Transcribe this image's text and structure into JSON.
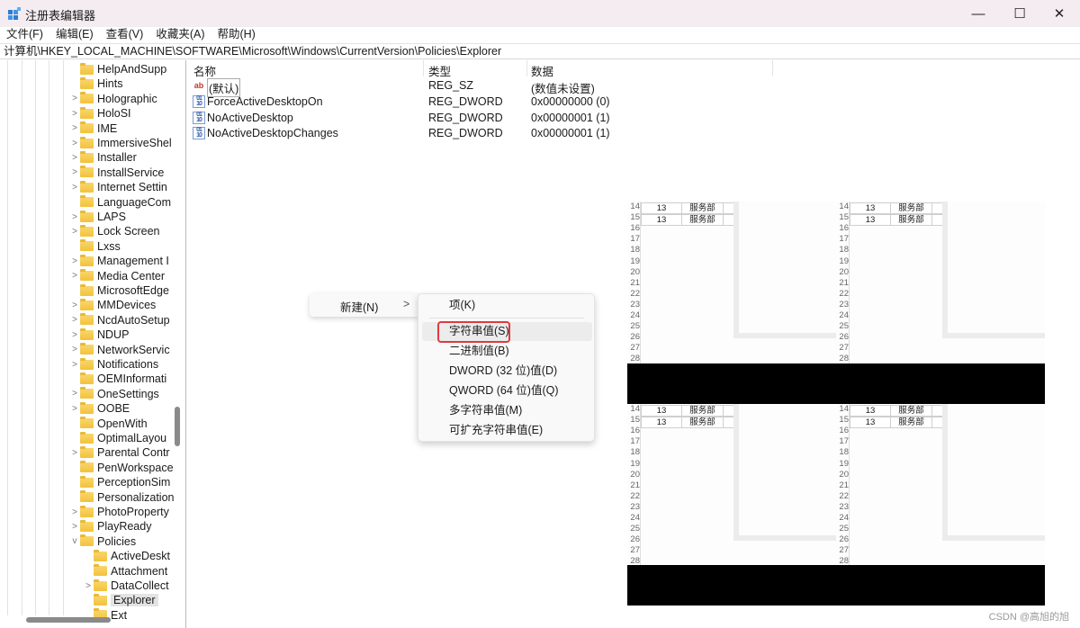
{
  "window": {
    "title": "注册表编辑器",
    "minimize": "—",
    "maximize": "☐",
    "close": "✕"
  },
  "menu": [
    "文件(F)",
    "编辑(E)",
    "查看(V)",
    "收藏夹(A)",
    "帮助(H)"
  ],
  "address": "计算机\\HKEY_LOCAL_MACHINE\\SOFTWARE\\Microsoft\\Windows\\CurrentVersion\\Policies\\Explorer",
  "tree": [
    {
      "label": "HelpAndSupp",
      "exp": "",
      "lvl": 0
    },
    {
      "label": "Hints",
      "exp": "",
      "lvl": 0
    },
    {
      "label": "Holographic",
      "exp": ">",
      "lvl": 0
    },
    {
      "label": "HoloSI",
      "exp": ">",
      "lvl": 0
    },
    {
      "label": "IME",
      "exp": ">",
      "lvl": 0
    },
    {
      "label": "ImmersiveShel",
      "exp": ">",
      "lvl": 0
    },
    {
      "label": "Installer",
      "exp": ">",
      "lvl": 0
    },
    {
      "label": "InstallService",
      "exp": ">",
      "lvl": 0
    },
    {
      "label": "Internet Settin",
      "exp": ">",
      "lvl": 0
    },
    {
      "label": "LanguageCom",
      "exp": "",
      "lvl": 0
    },
    {
      "label": "LAPS",
      "exp": ">",
      "lvl": 0
    },
    {
      "label": "Lock Screen",
      "exp": ">",
      "lvl": 0
    },
    {
      "label": "Lxss",
      "exp": "",
      "lvl": 0
    },
    {
      "label": "Management I",
      "exp": ">",
      "lvl": 0
    },
    {
      "label": "Media Center",
      "exp": ">",
      "lvl": 0
    },
    {
      "label": "MicrosoftEdge",
      "exp": "",
      "lvl": 0
    },
    {
      "label": "MMDevices",
      "exp": ">",
      "lvl": 0
    },
    {
      "label": "NcdAutoSetup",
      "exp": ">",
      "lvl": 0
    },
    {
      "label": "NDUP",
      "exp": ">",
      "lvl": 0
    },
    {
      "label": "NetworkServic",
      "exp": ">",
      "lvl": 0
    },
    {
      "label": "Notifications",
      "exp": ">",
      "lvl": 0
    },
    {
      "label": "OEMInformati",
      "exp": "",
      "lvl": 0
    },
    {
      "label": "OneSettings",
      "exp": ">",
      "lvl": 0
    },
    {
      "label": "OOBE",
      "exp": ">",
      "lvl": 0
    },
    {
      "label": "OpenWith",
      "exp": "",
      "lvl": 0
    },
    {
      "label": "OptimalLayou",
      "exp": "",
      "lvl": 0
    },
    {
      "label": "Parental Contr",
      "exp": ">",
      "lvl": 0
    },
    {
      "label": "PenWorkspace",
      "exp": "",
      "lvl": 0
    },
    {
      "label": "PerceptionSim",
      "exp": "",
      "lvl": 0
    },
    {
      "label": "Personalization",
      "exp": "",
      "lvl": 0
    },
    {
      "label": "PhotoProperty",
      "exp": ">",
      "lvl": 0
    },
    {
      "label": "PlayReady",
      "exp": ">",
      "lvl": 0
    },
    {
      "label": "Policies",
      "exp": "v",
      "lvl": 0
    },
    {
      "label": "ActiveDeskt",
      "exp": "",
      "lvl": 1
    },
    {
      "label": "Attachment",
      "exp": "",
      "lvl": 1
    },
    {
      "label": "DataCollect",
      "exp": ">",
      "lvl": 1
    },
    {
      "label": "Explorer",
      "exp": "",
      "lvl": 1,
      "selected": true
    },
    {
      "label": "Ext",
      "exp": "",
      "lvl": 1
    }
  ],
  "list": {
    "headers": [
      "名称",
      "类型",
      "数据"
    ],
    "rows": [
      {
        "icon": "string-value-icon",
        "name": "(默认)",
        "type": "REG_SZ",
        "data": "(数值未设置)"
      },
      {
        "icon": "dword-value-icon",
        "name": "ForceActiveDesktopOn",
        "type": "REG_DWORD",
        "data": "0x00000000 (0)"
      },
      {
        "icon": "dword-value-icon",
        "name": "NoActiveDesktop",
        "type": "REG_DWORD",
        "data": "0x00000001 (1)"
      },
      {
        "icon": "dword-value-icon",
        "name": "NoActiveDesktopChanges",
        "type": "REG_DWORD",
        "data": "0x00000001 (1)"
      }
    ]
  },
  "context_menu": {
    "new": "新建(N)",
    "arrow": ">",
    "submenu": [
      "项(K)",
      "字符串值(S)",
      "二进制值(B)",
      "DWORD (32 位)值(D)",
      "QWORD (64 位)值(Q)",
      "多字符串值(M)",
      "可扩充字符串值(E)"
    ]
  },
  "sheet": {
    "rows": [
      "14",
      "15",
      "16",
      "17",
      "18",
      "19",
      "20",
      "21",
      "22",
      "23",
      "24",
      "25",
      "26",
      "27",
      "28"
    ],
    "cell_num": "13",
    "cell_dept": "服务部"
  },
  "watermark": "CSDN @高旭的旭",
  "colors": {
    "highlight_border": "#e0393e",
    "folder": "#f2c23c"
  }
}
